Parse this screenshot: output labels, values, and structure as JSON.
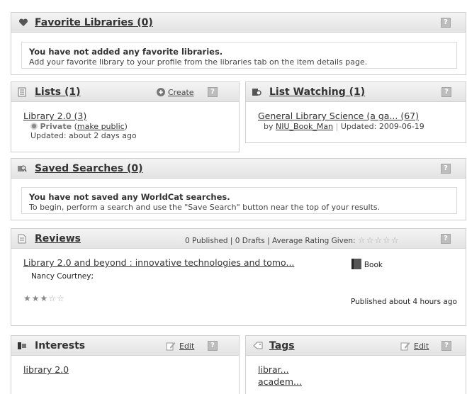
{
  "favorites": {
    "title": "Favorite Libraries (0)",
    "notice_title": "You have not added any favorite libraries.",
    "notice_body": "Add your favorite library to your profile from the libraries tab on the item details page."
  },
  "lists": {
    "title": "Lists (1)",
    "create_label": "Create",
    "item_title": "Library 2.0 (3)",
    "privacy_label": "Private",
    "make_public_label": "make public",
    "updated": "Updated: about 2 days ago"
  },
  "list_watching": {
    "title": "List Watching (1)",
    "item_title": "General Library Science (a ga... (67)",
    "by_label": "by",
    "author": "NIU_Book_Man",
    "separator": "|",
    "updated": "Updated: 2009-06-19"
  },
  "saved_searches": {
    "title": "Saved Searches (0)",
    "notice_title": "You have not saved any WorldCat searches.",
    "notice_body": "To begin, perform a search and use the \"Save Search\" button near the top of your results."
  },
  "reviews": {
    "title": "Reviews",
    "stats": "0 Published | 0 Drafts | Average Rating Given:",
    "avg_rating": 0,
    "item_title": "Library 2.0 and beyond : innovative technologies and tomo...",
    "item_author": "Nancy Courtney;",
    "format_label": "Book",
    "item_rating": 3,
    "published": "Published about 4 hours ago"
  },
  "interests": {
    "title": "Interests",
    "edit_label": "Edit",
    "items": [
      "library 2.0"
    ]
  },
  "tags": {
    "title": "Tags",
    "edit_label": "Edit",
    "items": [
      "librar...",
      "academ..."
    ]
  },
  "help_label": "?"
}
